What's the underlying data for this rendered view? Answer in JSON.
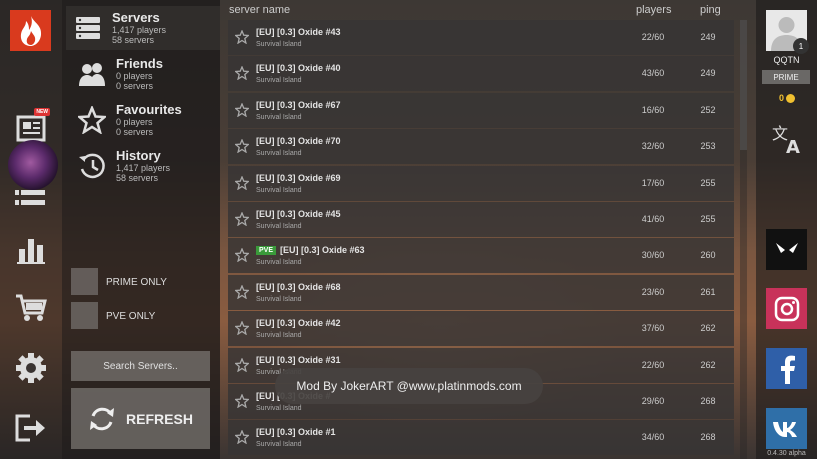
{
  "header": {
    "server_name": "server name",
    "players": "players",
    "ping": "ping"
  },
  "categories": [
    {
      "title": "Servers",
      "line1": "1,417 players",
      "line2": "58 servers",
      "icon": "server-icon",
      "active": true
    },
    {
      "title": "Friends",
      "line1": "0 players",
      "line2": "0 servers",
      "icon": "friends-icon"
    },
    {
      "title": "Favourites",
      "line1": "0 players",
      "line2": "0 servers",
      "icon": "star-icon"
    },
    {
      "title": "History",
      "line1": "1,417 players",
      "line2": "58 servers",
      "icon": "history-icon"
    }
  ],
  "filters": {
    "prime_only": "PRIME ONLY",
    "pve_only": "PVE ONLY"
  },
  "search": {
    "placeholder": "Search Servers.."
  },
  "refresh": {
    "label": "REFRESH"
  },
  "rail": {
    "new_badge": "NEW"
  },
  "servers": [
    {
      "name": "[EU] [0.3] Oxide #43",
      "mode": "Survival Island",
      "players": "22/60",
      "ping": "249"
    },
    {
      "name": "[EU] [0.3] Oxide #40",
      "mode": "Survival Island",
      "players": "43/60",
      "ping": "249"
    },
    {
      "name": "[EU] [0.3] Oxide #67",
      "mode": "Survival Island",
      "players": "16/60",
      "ping": "252"
    },
    {
      "name": "[EU] [0.3] Oxide #70",
      "mode": "Survival Island",
      "players": "32/60",
      "ping": "253"
    },
    {
      "name": "[EU] [0.3] Oxide #69",
      "mode": "Survival Island",
      "players": "17/60",
      "ping": "255"
    },
    {
      "name": "[EU] [0.3] Oxide #45",
      "mode": "Survival Island",
      "players": "41/60",
      "ping": "255"
    },
    {
      "name": "[EU] [0.3] Oxide #63",
      "mode": "Survival Island",
      "players": "30/60",
      "ping": "260",
      "badge": "PVE"
    },
    {
      "name": "[EU] [0.3] Oxide #68",
      "mode": "Survival Island",
      "players": "23/60",
      "ping": "261"
    },
    {
      "name": "[EU] [0.3] Oxide #42",
      "mode": "Survival Island",
      "players": "37/60",
      "ping": "262"
    },
    {
      "name": "[EU] [0.3] Oxide #31",
      "mode": "Survival Island",
      "players": "22/60",
      "ping": "262"
    },
    {
      "name": "[EU] [0.3] Oxide #",
      "mode": "Survival Island",
      "players": "29/60",
      "ping": "268"
    },
    {
      "name": "[EU] [0.3] Oxide #1",
      "mode": "Survival Island",
      "players": "34/60",
      "ping": "268"
    }
  ],
  "user": {
    "name": "QQTN",
    "level": "1",
    "prime": "PRIME",
    "coins": "0"
  },
  "version": "0.4.30 alpha",
  "toast": "Mod By JokerART @www.platinmods.com",
  "colors": {
    "logo": "#d93a1e",
    "pve_badge": "#3a9a3a",
    "instagram": "#c8325a",
    "facebook": "#2f5fa8",
    "vk": "#2f6fa8",
    "coin": "#f0c030"
  }
}
